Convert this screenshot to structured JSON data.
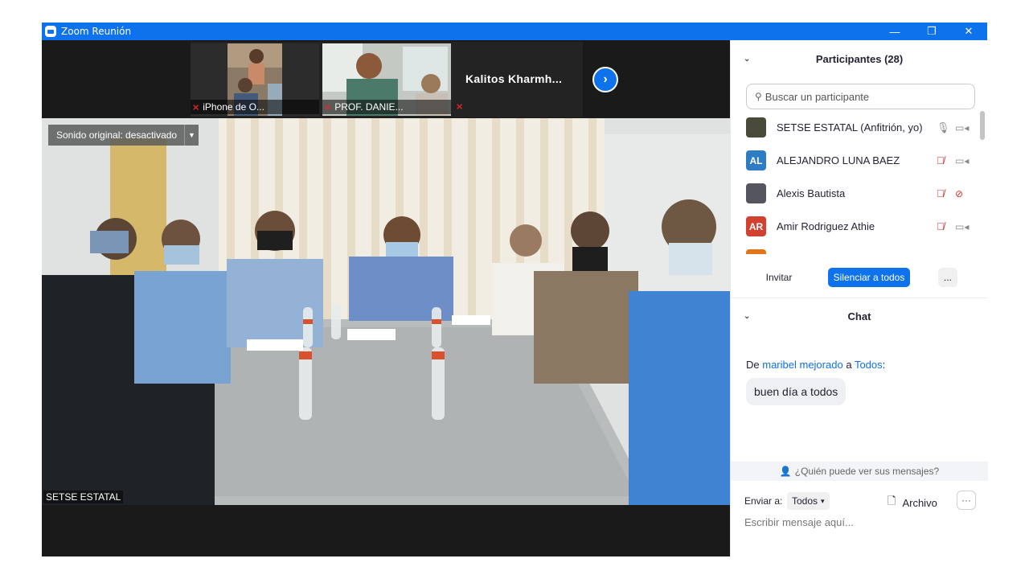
{
  "window": {
    "title": "Zoom Reunión",
    "controls": {
      "minimize": "—",
      "restore": "❐",
      "close": "✕"
    }
  },
  "gallery_strip": {
    "thumbnails": [
      {
        "label": "iPhone de O..."
      },
      {
        "label": "PROF. DANIE..."
      }
    ],
    "text_participant": "Kalitos  Kharmh...",
    "next_icon": "chevron-right-icon"
  },
  "main_video": {
    "original_sound": "Sonido original: desactivado",
    "speaker_name": "SETSE ESTATAL"
  },
  "participants": {
    "header": "Participantes (28)",
    "search_placeholder": "Buscar un participante",
    "list": [
      {
        "name": "SETSE ESTATAL (Anfitrión, yo)",
        "avatar": "",
        "avatar_color": "#4a4a3a",
        "mic": "on",
        "cam": "on"
      },
      {
        "name": "ALEJANDRO LUNA BAEZ",
        "avatar": "AL",
        "avatar_color": "#2d7cc4",
        "mic": "muted",
        "cam": "on"
      },
      {
        "name": "Alexis Bautista",
        "avatar": "",
        "avatar_color": "#555560",
        "mic": "muted",
        "cam": "off"
      },
      {
        "name": "Amir Rodriguez Athie",
        "avatar": "AR",
        "avatar_color": "#d2402f",
        "mic": "muted",
        "cam": "on"
      },
      {
        "name": "",
        "avatar": "",
        "avatar_color": "#e0761b",
        "mic": "muted",
        "cam": "on"
      }
    ],
    "buttons": {
      "invite": "Invitar",
      "mute_all": "Silenciar a todos",
      "more": "..."
    }
  },
  "chat": {
    "header": "Chat",
    "message": {
      "prefix": "De",
      "from": "maribel mejorado",
      "middle": "a",
      "to": "Todos",
      "suffix": ":",
      "text": "buen día a todos"
    },
    "who_can_see": "¿Quién puede ver sus mensajes?",
    "send_to_label": "Enviar a:",
    "send_to_value": "Todos",
    "file_label": "Archivo",
    "more": "···",
    "input_placeholder": "Escribir mensaje aquí..."
  },
  "colors": {
    "accent": "#0e72ed",
    "muted_red": "#e02828",
    "titlebar": "#0e72ed"
  }
}
